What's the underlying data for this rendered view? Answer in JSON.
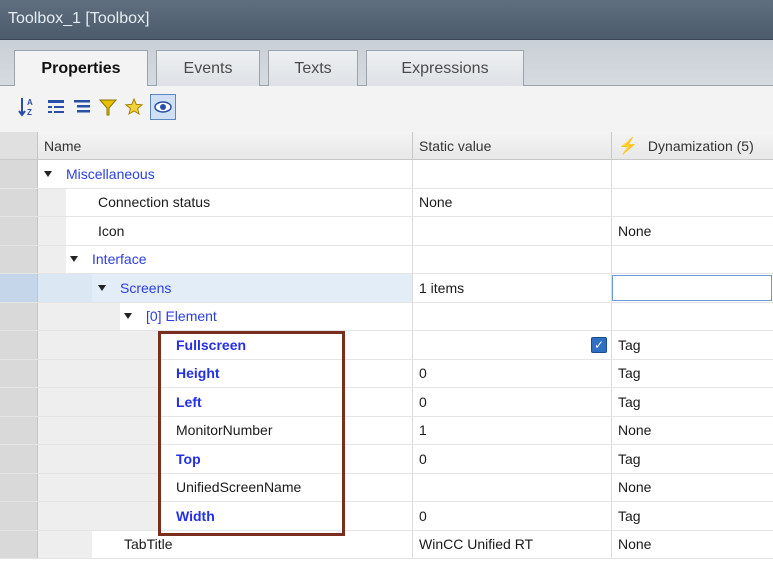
{
  "window": {
    "title": "Toolbox_1 [Toolbox]"
  },
  "tabs": [
    {
      "label": "Properties",
      "active": true
    },
    {
      "label": "Events",
      "active": false
    },
    {
      "label": "Texts",
      "active": false
    },
    {
      "label": "Expressions",
      "active": false
    }
  ],
  "toolbar": {
    "buttons": [
      {
        "icon": "sort-az-icon"
      },
      {
        "icon": "group-tree-icon"
      },
      {
        "icon": "list-view-icon"
      },
      {
        "icon": "filter-icon"
      },
      {
        "icon": "favorites-star-icon"
      },
      {
        "icon": "show-eye-icon",
        "pressed": true
      }
    ]
  },
  "columns": {
    "name": "Name",
    "static": "Static value",
    "dynamization": "Dynamization (5)"
  },
  "rows": [
    {
      "name": "Miscellaneous",
      "static": "",
      "dyn": "",
      "group": true
    },
    {
      "name": "Connection status",
      "static": "None",
      "dyn": ""
    },
    {
      "name": "Icon",
      "static": "",
      "dyn": "None"
    },
    {
      "name": "Interface",
      "static": "",
      "dyn": "",
      "group": true
    },
    {
      "name": "Screens",
      "static": "1 items",
      "dyn": "",
      "group": true
    },
    {
      "name": "[0] Element",
      "static": "",
      "dyn": "",
      "group": true
    },
    {
      "name": "Fullscreen",
      "static": "",
      "dyn": "Tag",
      "checked": true,
      "dynamized": true
    },
    {
      "name": "Height",
      "static": "0",
      "dyn": "Tag",
      "dynamized": true
    },
    {
      "name": "Left",
      "static": "0",
      "dyn": "Tag",
      "dynamized": true
    },
    {
      "name": "MonitorNumber",
      "static": "1",
      "dyn": "None"
    },
    {
      "name": "Top",
      "static": "0",
      "dyn": "Tag",
      "dynamized": true
    },
    {
      "name": "UnifiedScreenName",
      "static": "",
      "dyn": "None"
    },
    {
      "name": "Width",
      "static": "0",
      "dyn": "Tag",
      "dynamized": true
    },
    {
      "name": "TabTitle",
      "static": "WinCC Unified RT",
      "dyn": "None"
    }
  ],
  "colors": {
    "group_text": "#2b3fe0",
    "dynamized_text": "#2430e6",
    "highlight_border": "#7a2e1e",
    "checkbox_fill": "#2f6fc4"
  }
}
